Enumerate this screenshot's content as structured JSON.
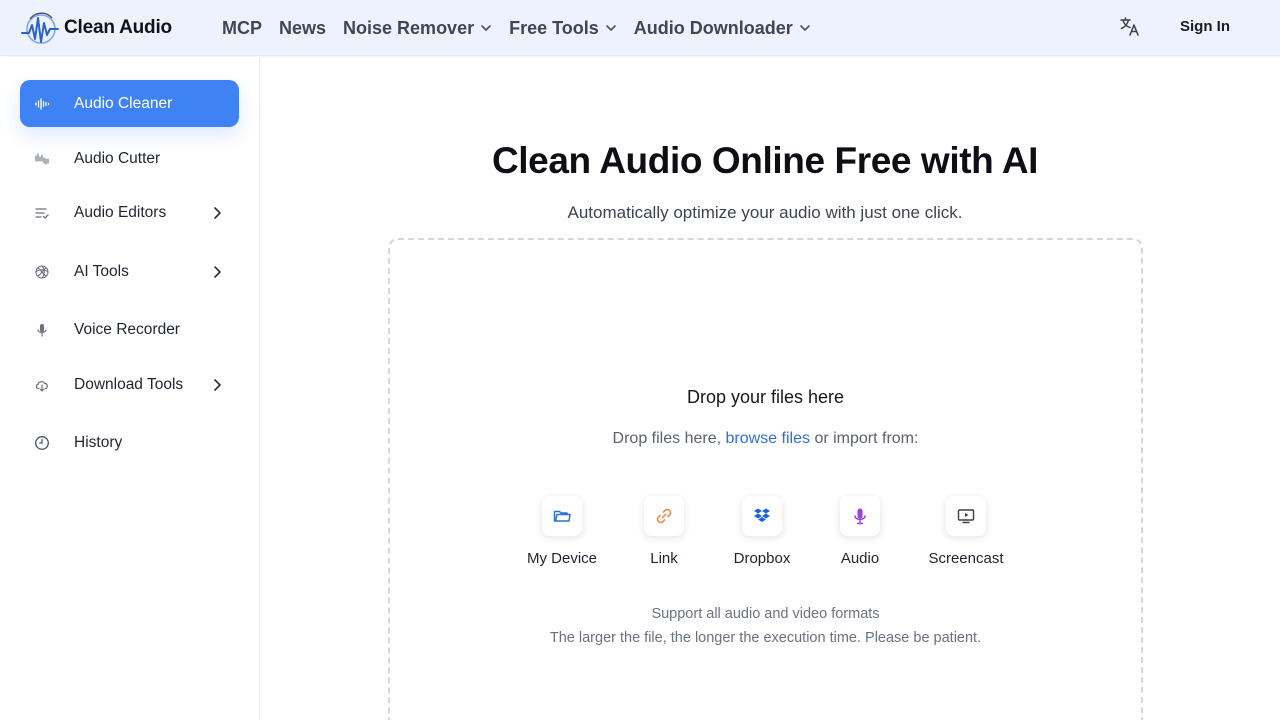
{
  "header": {
    "logo_text": "Clean Audio",
    "nav": [
      {
        "label": "MCP",
        "has_dropdown": false
      },
      {
        "label": "News",
        "has_dropdown": false
      },
      {
        "label": "Noise Remover",
        "has_dropdown": true
      },
      {
        "label": "Free Tools",
        "has_dropdown": true
      },
      {
        "label": "Audio Downloader",
        "has_dropdown": true
      }
    ],
    "language_icon": "translate-icon",
    "sign_in_label": "Sign In"
  },
  "sidebar": {
    "items": [
      {
        "label": "Audio Cleaner",
        "icon": "waveform-icon",
        "active": true,
        "has_submenu": false
      },
      {
        "label": "Audio Cutter",
        "icon": "audio-bars-icon",
        "active": false,
        "has_submenu": false
      },
      {
        "label": "Audio Editors",
        "icon": "playlist-edit-icon",
        "active": false,
        "has_submenu": true
      },
      {
        "label": "AI Tools",
        "icon": "ai-spiral-icon",
        "active": false,
        "has_submenu": true
      },
      {
        "label": "Voice Recorder",
        "icon": "microphone-icon",
        "active": false,
        "has_submenu": false
      },
      {
        "label": "Download Tools",
        "icon": "cloud-download-icon",
        "active": false,
        "has_submenu": true
      },
      {
        "label": "History",
        "icon": "clock-icon",
        "active": false,
        "has_submenu": false
      }
    ]
  },
  "main": {
    "title": "Clean Audio Online Free with AI",
    "subtitle": "Automatically optimize your audio with just one click.",
    "dropzone": {
      "title": "Drop your files here",
      "prompt_before": "Drop files here,",
      "browse_label": "browse files",
      "prompt_after": "or import from:",
      "sources": [
        {
          "label": "My Device",
          "icon": "folder-icon"
        },
        {
          "label": "Link",
          "icon": "link-icon"
        },
        {
          "label": "Dropbox",
          "icon": "dropbox-icon"
        },
        {
          "label": "Audio",
          "icon": "microphone-icon"
        },
        {
          "label": "Screencast",
          "icon": "screencast-icon"
        }
      ],
      "note_formats": "Support all audio and video formats",
      "note_time": "The larger the file, the longer the execution time. Please be patient."
    }
  },
  "colors": {
    "accent": "#3f82f4",
    "header_bg": "#edf2fc",
    "link": "#2e6fdc",
    "folder_icon": "#2f6fd6",
    "link_icon": "#f08a4b",
    "dropbox_icon": "#1a63e0",
    "audio_icon": "#9b3fe0",
    "screencast_icon": "#3a3f4a"
  }
}
